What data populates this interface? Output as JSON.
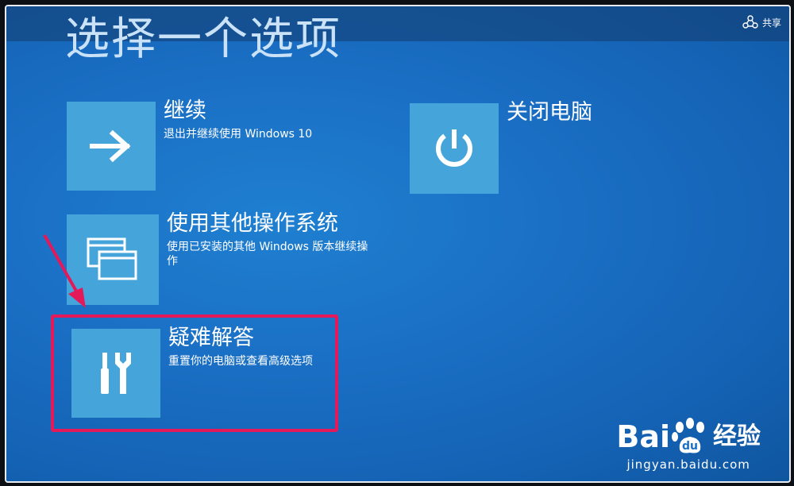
{
  "header": {
    "title": "选择一个选项",
    "share_label": "共享",
    "share_icon": "share-icon"
  },
  "options": [
    {
      "id": "continue",
      "title": "继续",
      "desc": "退出并继续使用 Windows 10",
      "icon": "arrow-right-icon"
    },
    {
      "id": "other-os",
      "title": "使用其他操作系统",
      "desc": "使用已安装的其他 Windows 版本继续操作",
      "icon": "windows-stack-icon"
    },
    {
      "id": "troubleshoot",
      "title": "疑难解答",
      "desc": "重置你的电脑或查看高级选项",
      "icon": "tools-icon"
    },
    {
      "id": "shutdown",
      "title": "关闭电脑",
      "desc": "",
      "icon": "power-icon"
    }
  ],
  "annotation": {
    "highlight_color": "#e3195a",
    "highlighted_option": "troubleshoot"
  },
  "watermark": {
    "logo_left": "Bai",
    "logo_right": "经验",
    "url": "jingyan.baidu.com"
  },
  "colors": {
    "background": "#1a6fc4",
    "tile": "#45a5da",
    "text": "#ffffff"
  }
}
